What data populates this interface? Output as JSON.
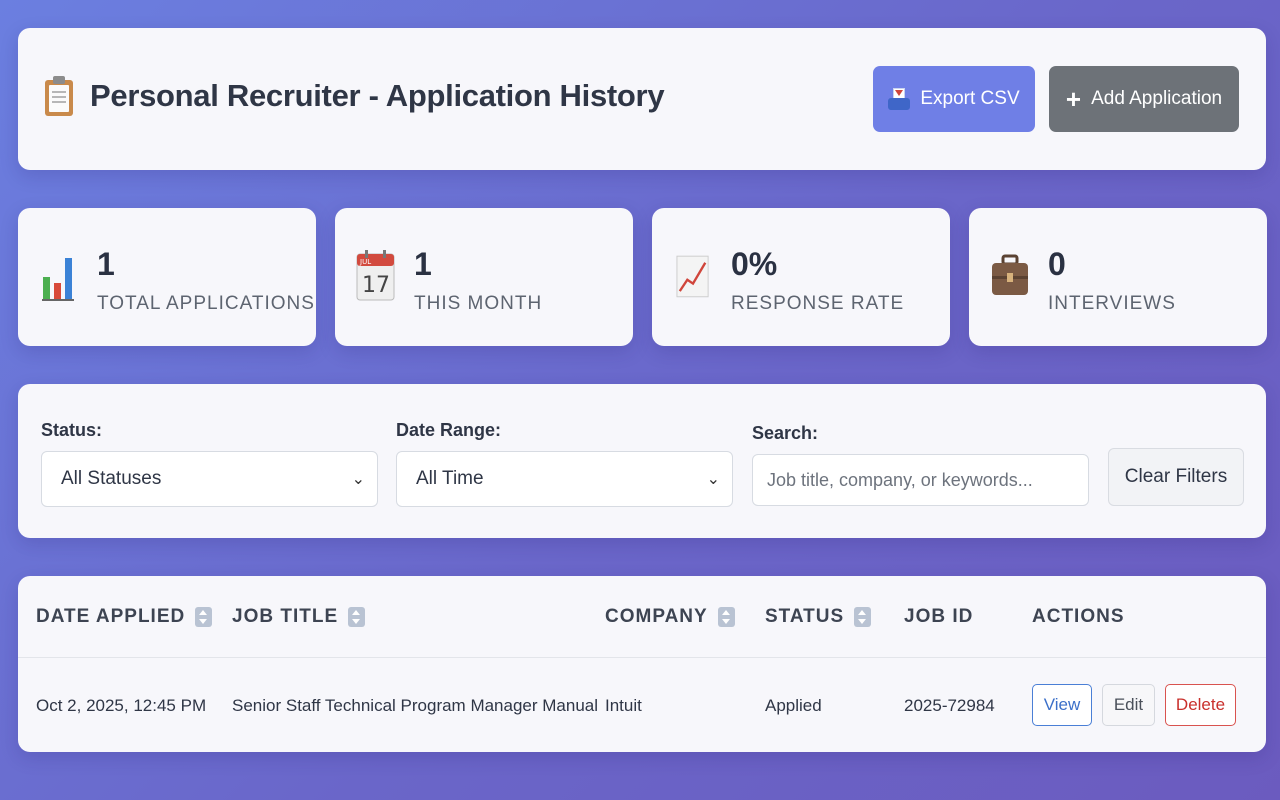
{
  "header": {
    "title": "Personal Recruiter - Application History",
    "title_icon": "clipboard-icon",
    "export_label": "Export CSV",
    "export_icon": "outbox-tray-icon",
    "add_label": "Add Application",
    "add_icon": "plus-icon"
  },
  "stats": [
    {
      "value": "1",
      "label": "TOTAL APPLICATIONS",
      "icon": "bar-chart-icon"
    },
    {
      "value": "1",
      "label": "THIS MONTH",
      "icon": "calendar-icon"
    },
    {
      "value": "0%",
      "label": "RESPONSE RATE",
      "icon": "trend-chart-icon"
    },
    {
      "value": "0",
      "label": "INTERVIEWS",
      "icon": "briefcase-icon"
    }
  ],
  "calendar_icon": {
    "month": "JUL",
    "day": "17"
  },
  "filters": {
    "status_label": "Status:",
    "status_value": "All Statuses",
    "date_label": "Date Range:",
    "date_value": "All Time",
    "search_label": "Search:",
    "search_placeholder": "Job title, company, or keywords...",
    "clear_label": "Clear Filters"
  },
  "table": {
    "columns": [
      "DATE APPLIED",
      "JOB TITLE",
      "COMPANY",
      "STATUS",
      "JOB ID",
      "ACTIONS"
    ],
    "rows": [
      {
        "date": "Oct 2, 2025, 12:45 PM",
        "title": "Senior Staff Technical Program Manager Manual",
        "company": "Intuit",
        "status": "Applied",
        "job_id": "2025-72984",
        "actions": [
          "View",
          "Edit",
          "Delete"
        ]
      }
    ]
  },
  "colors": {
    "accent": "#6f7fe6",
    "secondary_button": "#6d7278",
    "view": "#3c70c9",
    "delete": "#c9302c"
  }
}
